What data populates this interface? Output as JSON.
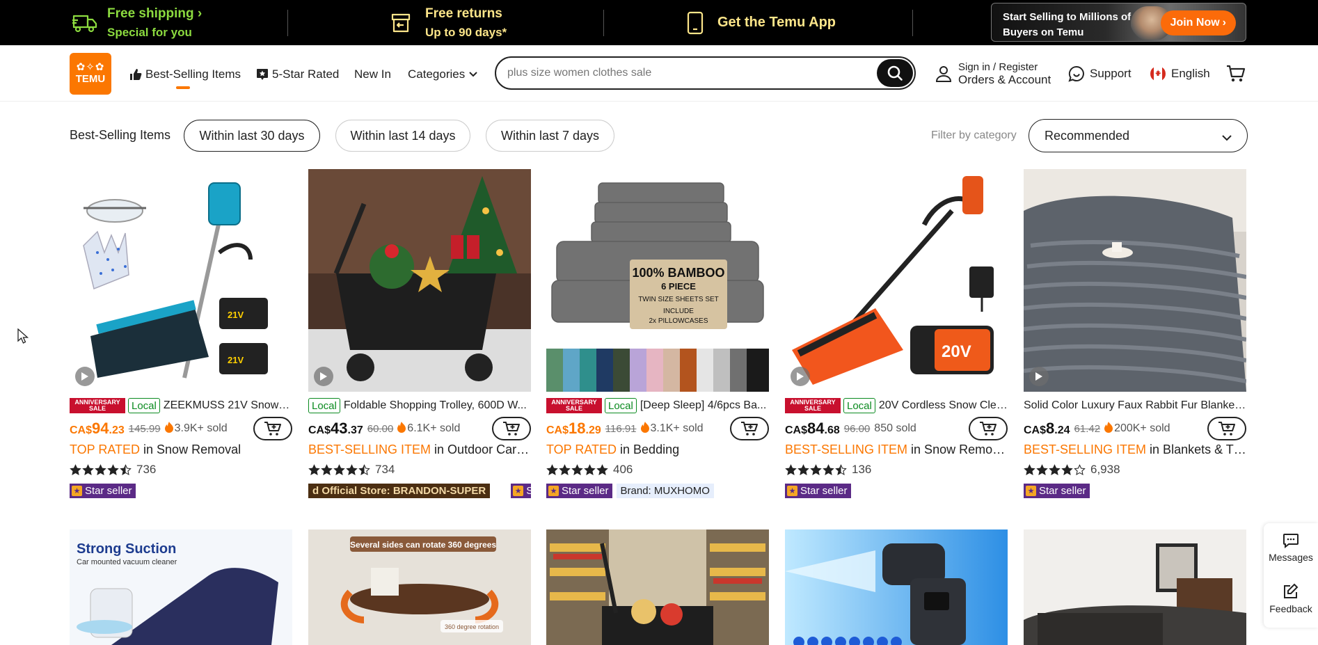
{
  "promo": {
    "shipping_line1": "Free shipping",
    "shipping_line2": "Special for you",
    "returns_line1": "Free returns",
    "returns_line2": "Up to 90 days*",
    "app_label": "Get the Temu App",
    "selling_text": "Start Selling to Millions of Buyers on Temu",
    "join_label": "Join Now"
  },
  "header": {
    "logo_text": "TEMU",
    "nav": {
      "best_selling": "Best-Selling Items",
      "five_star": "5-Star Rated",
      "new_in": "New In",
      "categories": "Categories"
    },
    "search_placeholder": "plus size women clothes sale",
    "sign_in_line1": "Sign in / Register",
    "sign_in_line2": "Orders & Account",
    "support": "Support",
    "language": "English"
  },
  "filters": {
    "label": "Best-Selling Items",
    "pills": [
      "Within last 30 days",
      "Within last 14 days",
      "Within last 7 days"
    ],
    "active_pill": 0,
    "filter_by_category": "Filter by category",
    "sort_value": "Recommended"
  },
  "products": [
    {
      "anniversary": true,
      "local": true,
      "title": "ZEEKMUSS 21V Snow S...",
      "currency": "CA$",
      "price_int": "94",
      "price_dec": ".23",
      "price_color": "orange",
      "orig": "145.99",
      "sold": "3.9K+ sold",
      "rank_prefix": "TOP RATED",
      "rank_suffix": " in Snow Removal",
      "rating": 4.5,
      "reviews": "736",
      "badges": [
        "star"
      ]
    },
    {
      "anniversary": false,
      "local": true,
      "title": "Foldable Shopping Trolley, 600D W...",
      "currency": "CA$",
      "price_int": "43",
      "price_dec": ".37",
      "price_color": "black",
      "orig": "60.00",
      "sold": "6.1K+ sold",
      "rank_prefix": "BEST-SELLING ITEM",
      "rank_suffix": " in Outdoor Carts &...",
      "rating": 4.5,
      "reviews": "734",
      "badges": [
        "official",
        "star"
      ],
      "official_text": "d Official Store: BRANDON-SUPER"
    },
    {
      "anniversary": true,
      "local": true,
      "title": "[Deep Sleep] 4/6pcs Ba...",
      "currency": "CA$",
      "price_int": "18",
      "price_dec": ".29",
      "price_color": "orange",
      "orig": "116.91",
      "sold": "3.1K+ sold",
      "rank_prefix": "TOP RATED",
      "rank_suffix": " in Bedding",
      "rating": 5,
      "reviews": "406",
      "badges": [
        "star",
        "brand"
      ],
      "brand_text": "Brand: MUXHOMO"
    },
    {
      "anniversary": true,
      "local": true,
      "title": "20V Cordless Snow Clea...",
      "currency": "CA$",
      "price_int": "84",
      "price_dec": ".68",
      "price_color": "black",
      "orig": "96.00",
      "sold": "850 sold",
      "rank_prefix": "BEST-SELLING ITEM",
      "rank_suffix": " in Snow Removal",
      "rating": 4.5,
      "reviews": "136",
      "badges": [
        "star"
      ]
    },
    {
      "anniversary": false,
      "local": false,
      "title": "Solid Color Luxury Faux Rabbit Fur Blanket ...",
      "currency": "CA$",
      "price_int": "8",
      "price_dec": ".24",
      "price_color": "black",
      "orig": "61.42",
      "sold": "200K+ sold",
      "rank_prefix": "BEST-SELLING ITEM",
      "rank_suffix": " in Blankets & Throws",
      "rating": 4.0,
      "reviews": "6,938",
      "badges": [
        "star"
      ]
    }
  ],
  "badge_text": {
    "anniversary_line1": "ANNIVERSARY",
    "anniversary_line2": "SALE",
    "local": "Local",
    "star_seller": "Star seller"
  },
  "second_row": {
    "strong_suction_title": "Strong Suction",
    "strong_suction_sub": "Car mounted vacuum cleaner",
    "rotate_label": "Several sides can rotate 360 degrees",
    "rotate_small": "360 degree rotation"
  },
  "product_image_text": {
    "bamboo_line1": "100% BAMBOO",
    "bamboo_line2": "6 PIECE",
    "bamboo_line3": "TWIN SIZE SHEETS SET",
    "bamboo_line4": "INCLUDE",
    "bamboo_line5": "2x PILLOWCASES",
    "battery_21v": "21V",
    "battery_20v": "20V"
  },
  "side": {
    "messages": "Messages",
    "feedback": "Feedback"
  },
  "colors": {
    "brand_orange": "#fb7701",
    "promo_green": "#8cdb3f",
    "promo_yellow": "#fde68a",
    "star_seller_purple": "#5b2a86",
    "anniversary_red": "#c8102e",
    "local_green": "#0a8a1f"
  },
  "icons": {
    "truck": "truck-icon",
    "return": "return-box-icon",
    "phone": "phone-icon",
    "thumbs_up": "thumbs-up-icon",
    "star_chat": "star-badge-icon",
    "search": "search-icon",
    "user": "user-icon",
    "support": "chat-bubble-icon",
    "flag": "canada-flag-icon",
    "cart": "cart-icon",
    "add_cart": "add-to-cart-icon",
    "play": "play-icon",
    "flame": "flame-icon",
    "messages": "messages-icon",
    "feedback": "feedback-icon"
  }
}
